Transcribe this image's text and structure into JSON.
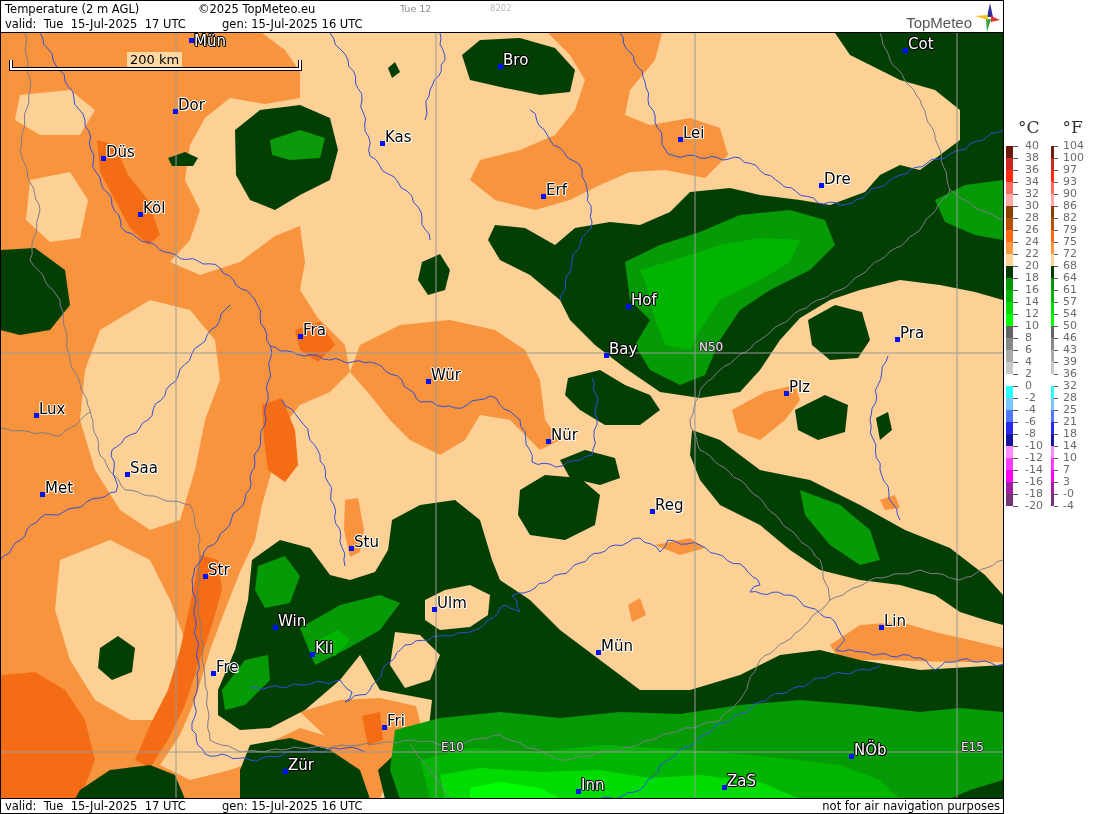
{
  "header": {
    "title": "Temperature (2 m AGL)",
    "copyright": "©2025 TopMeteo.eu",
    "run": "Tue 12",
    "code": "8202",
    "valid": "valid:  Tue  15-Jul-2025  17 UTC",
    "generated": "gen: 15-Jul-2025 16 UTC",
    "logo": "TopMeteo"
  },
  "map": {
    "scale_label": "200 km",
    "cities": [
      "Mün",
      "Bro",
      "Cot",
      "Dor",
      "Kas",
      "Düs",
      "Lei",
      "Erf",
      "Dre",
      "Köl",
      "Hof",
      "Fra",
      "Pra",
      "Bay",
      "Wür",
      "Plz",
      "Lux",
      "Nür",
      "Saa",
      "Met",
      "Reg",
      "Stu",
      "Str",
      "Ulm",
      "Lin",
      "Win",
      "Kli",
      "Mün",
      "Fre",
      "Fri",
      "NÖb",
      "Zür",
      "Inn",
      "ZaS"
    ],
    "grid_labels": [
      "N50",
      "E10",
      "E15"
    ]
  },
  "legend": {
    "celsius_header": "°C",
    "fahrenheit_header": "°F",
    "celsius_labels": [
      "40",
      "38",
      "36",
      "34",
      "32",
      "30",
      "28",
      "26",
      "24",
      "22",
      "20",
      "18",
      "16",
      "14",
      "12",
      "10",
      "8",
      "6",
      "4",
      "2",
      "0",
      "-2",
      "-4",
      "-6",
      "-8",
      "-10",
      "-12",
      "-14",
      "-16",
      "-18",
      "-20"
    ],
    "fahrenheit_labels": [
      "104",
      "100",
      "97",
      "93",
      "90",
      "86",
      "82",
      "79",
      "75",
      "72",
      "68",
      "64",
      "61",
      "57",
      "54",
      "50",
      "46",
      "43",
      "39",
      "36",
      "32",
      "28",
      "25",
      "21",
      "18",
      "14",
      "10",
      "7",
      "3",
      "-0",
      "-4"
    ],
    "bands": [
      {
        "kind": "swatch",
        "color": "#6e1a0e"
      },
      {
        "kind": "swatch",
        "color": "#c8281e"
      },
      {
        "kind": "swatch",
        "color": "#ff2a10"
      },
      {
        "kind": "swatch",
        "color": "#ff6e64"
      },
      {
        "kind": "swatch",
        "color": "#ffaaaa"
      },
      {
        "kind": "swatch",
        "color": "#8a4000"
      },
      {
        "kind": "swatch",
        "color": "#b45000"
      },
      {
        "kind": "swatch",
        "color": "#ff6a10"
      },
      {
        "kind": "swatch",
        "color": "#ff9640"
      },
      {
        "kind": "swatch",
        "color": "#ffd296"
      },
      {
        "kind": "swatch",
        "color": "#003c00"
      },
      {
        "kind": "swatch",
        "color": "#009600"
      },
      {
        "kind": "swatch",
        "color": "#00b400"
      },
      {
        "kind": "swatch",
        "color": "#00dc00"
      },
      {
        "kind": "swatch",
        "color": "#00ff00"
      },
      {
        "kind": "swatch",
        "color": "#646464"
      },
      {
        "kind": "swatch",
        "color": "#888888"
      },
      {
        "kind": "swatch",
        "color": "#aaaaaa"
      },
      {
        "kind": "swatch",
        "color": "#c8c8c8"
      },
      {
        "kind": "gap"
      },
      {
        "kind": "swatch",
        "color": "#28ffff"
      },
      {
        "kind": "swatch",
        "color": "#78c8ff"
      },
      {
        "kind": "swatch",
        "color": "#5078ff"
      },
      {
        "kind": "swatch",
        "color": "#2828f0"
      },
      {
        "kind": "swatch",
        "color": "#1414a0"
      },
      {
        "kind": "swatch",
        "color": "#ff8cff"
      },
      {
        "kind": "swatch",
        "color": "#ff3cff"
      },
      {
        "kind": "swatch",
        "color": "#ff00ff"
      },
      {
        "kind": "swatch",
        "color": "#a01ea0"
      },
      {
        "kind": "swatch",
        "color": "#783278"
      }
    ]
  },
  "footer": {
    "valid": "valid:  Tue  15-Jul-2025  17 UTC",
    "generated": "gen: 15-Jul-2025 16 UTC",
    "notice": "not for air navigation purposes"
  }
}
